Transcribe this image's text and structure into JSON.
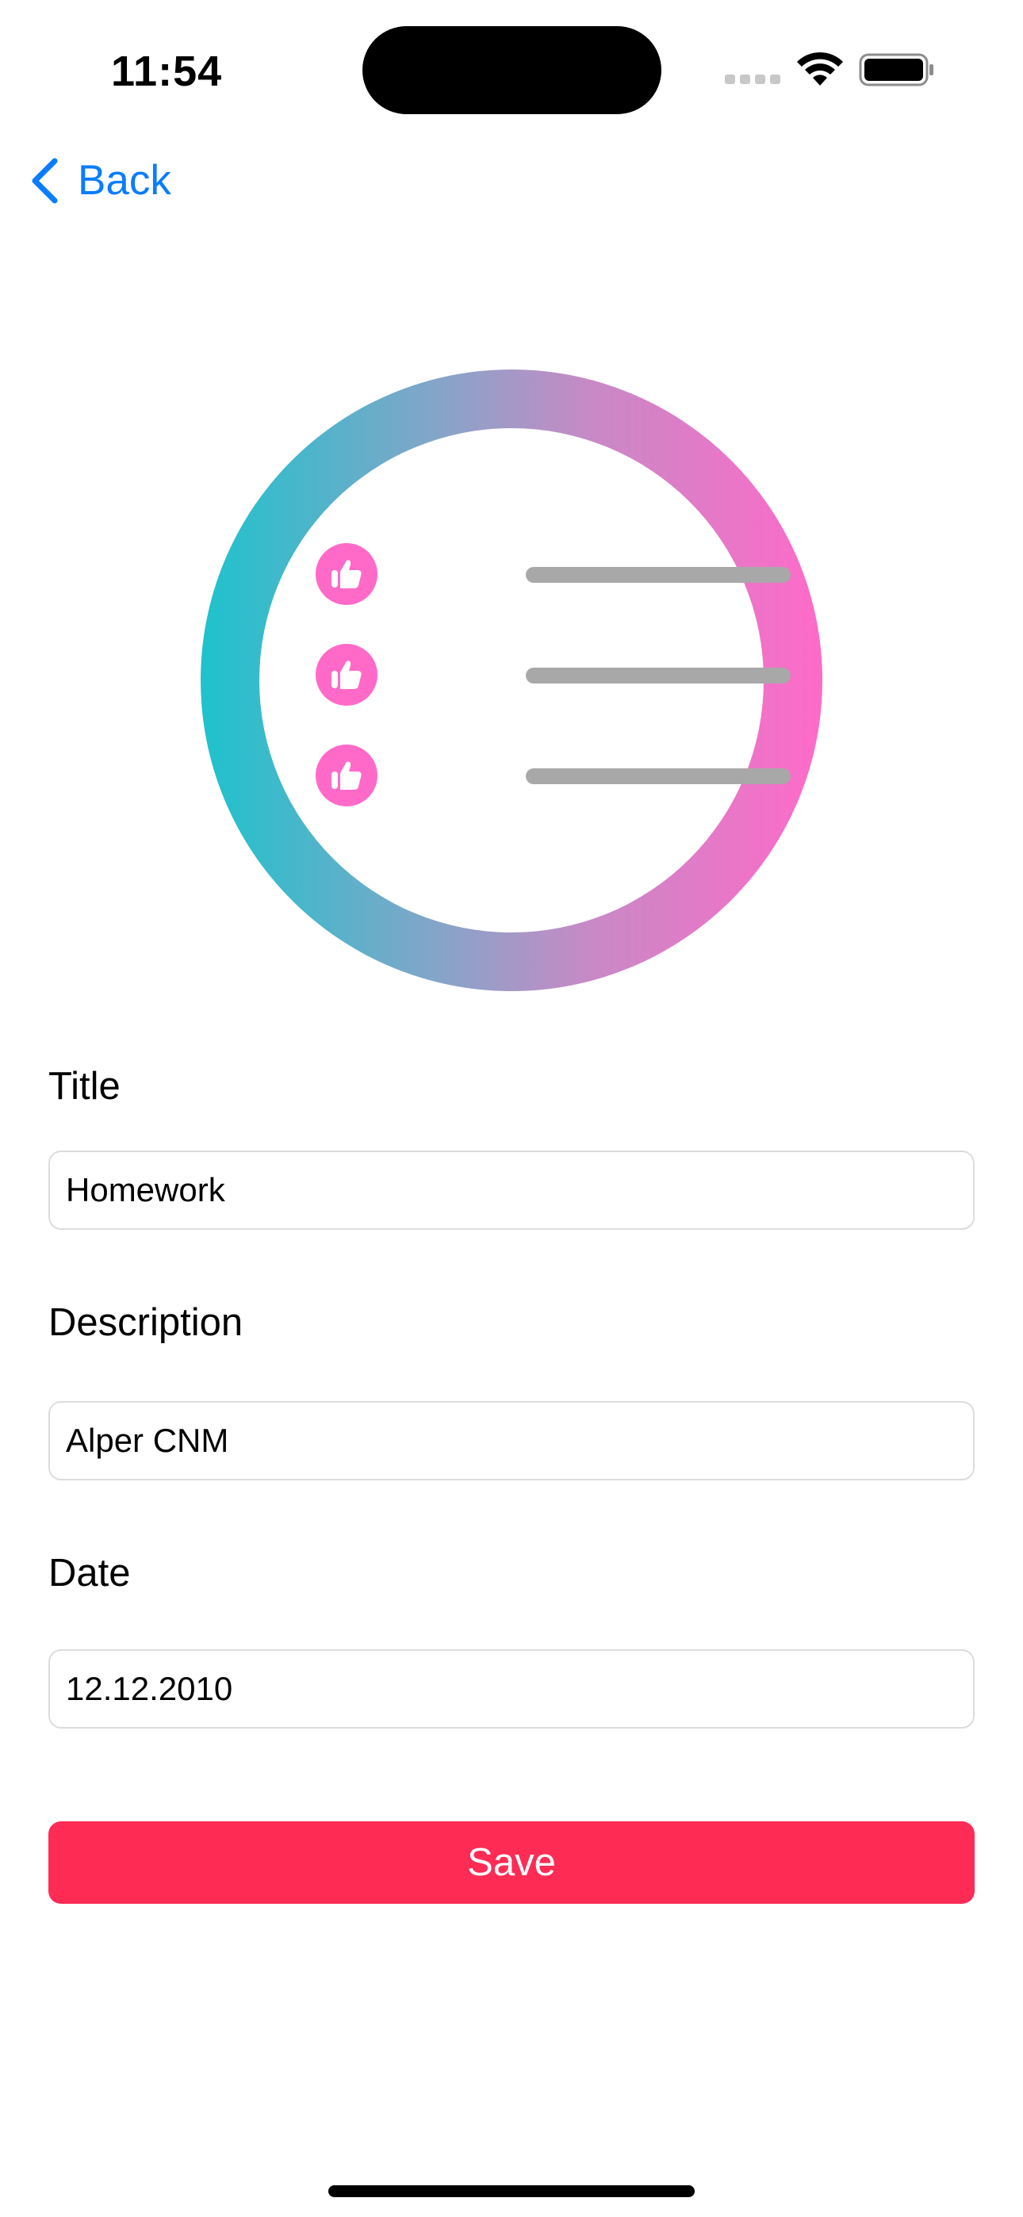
{
  "status_bar": {
    "time": "11:54"
  },
  "nav": {
    "back_label": "Back"
  },
  "illustration": {
    "icons": [
      "thumbs-up-icon",
      "thumbs-up-icon",
      "thumbs-up-icon"
    ],
    "ring_colors": [
      "#1dc3cc",
      "#ff6ac8"
    ],
    "badge_color": "#ff6ac8"
  },
  "form": {
    "title": {
      "label": "Title",
      "value": "Homework"
    },
    "description": {
      "label": "Description",
      "value": "Alper CNM"
    },
    "date": {
      "label": "Date",
      "value": "12.12.2010"
    }
  },
  "actions": {
    "save_label": "Save",
    "save_color": "#fe2c55"
  },
  "colors": {
    "accent": "#0a7cff"
  }
}
